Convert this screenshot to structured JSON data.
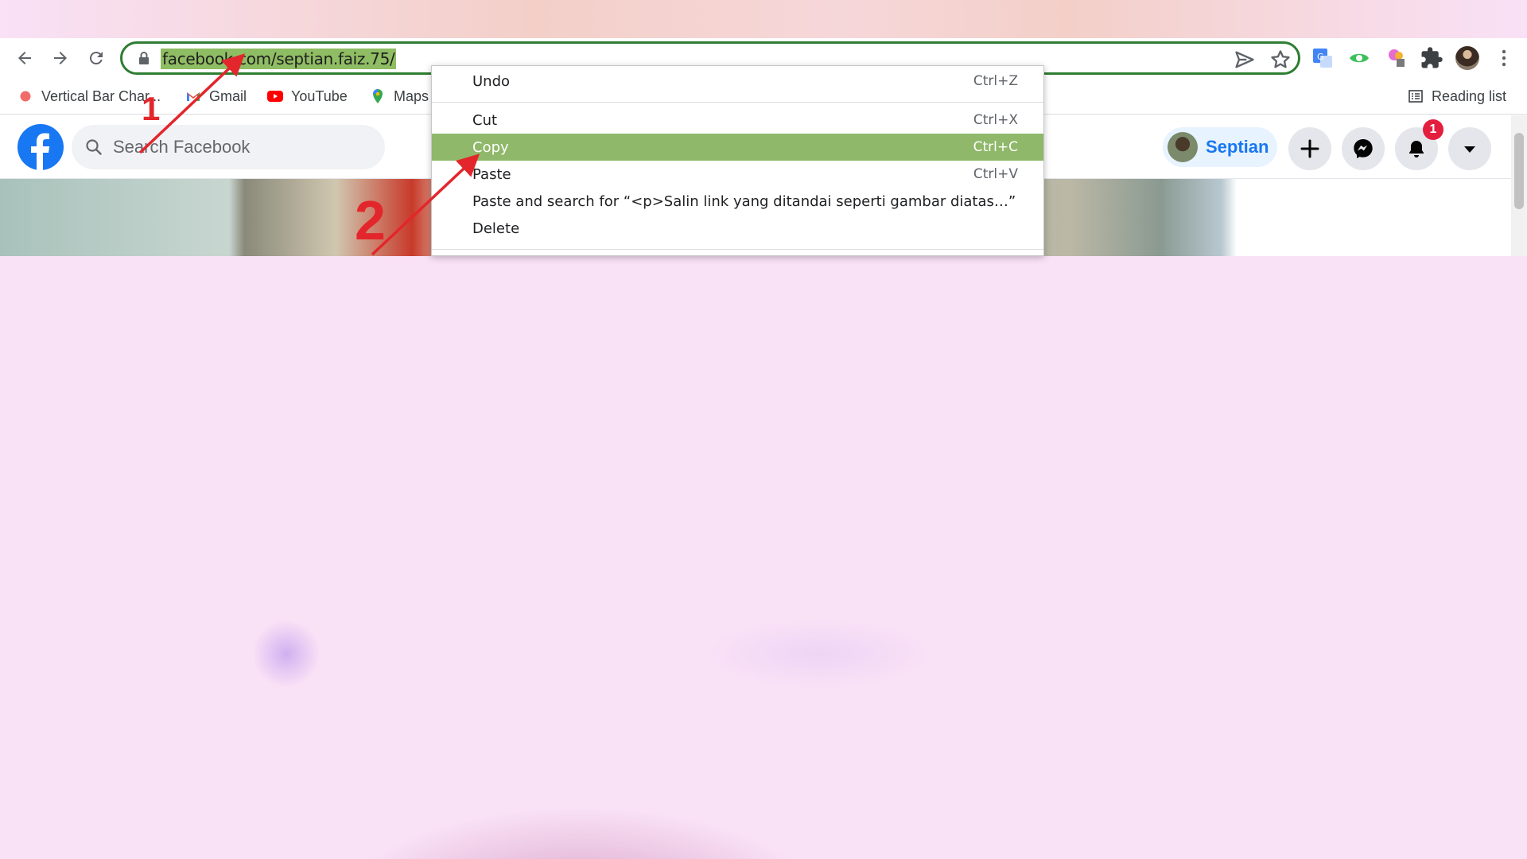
{
  "browser": {
    "url": "facebook.com/septian.faiz.75/",
    "bookmarks": [
      {
        "label": "Vertical Bar Char...",
        "icon": "bar-chart-favicon-icon"
      },
      {
        "label": "Gmail",
        "icon": "gmail-icon"
      },
      {
        "label": "YouTube",
        "icon": "youtube-icon"
      },
      {
        "label": "Maps",
        "icon": "maps-icon"
      }
    ],
    "reading_list": "Reading list"
  },
  "facebook": {
    "search_placeholder": "Search Facebook",
    "profile_name": "Septian",
    "notification_count": "1"
  },
  "context_menu": {
    "items": [
      {
        "label": "Undo",
        "shortcut": "Ctrl+Z"
      },
      {
        "label": "Cut",
        "shortcut": "Ctrl+X"
      },
      {
        "label": "Copy",
        "shortcut": "Ctrl+C",
        "active": true
      },
      {
        "label": "Paste",
        "shortcut": "Ctrl+V"
      },
      {
        "label": "Paste and search for “<p>Salin link yang ditandai seperti gambar diatas…”",
        "shortcut": ""
      },
      {
        "label": "Delete",
        "shortcut": ""
      }
    ]
  },
  "annotations": {
    "step1": "1",
    "step2": "2"
  },
  "colors": {
    "facebook_blue": "#1877f2",
    "highlight_green": "#8fb86a",
    "annotation_red": "#e3262b",
    "omnibox_border": "#2e7d32"
  }
}
